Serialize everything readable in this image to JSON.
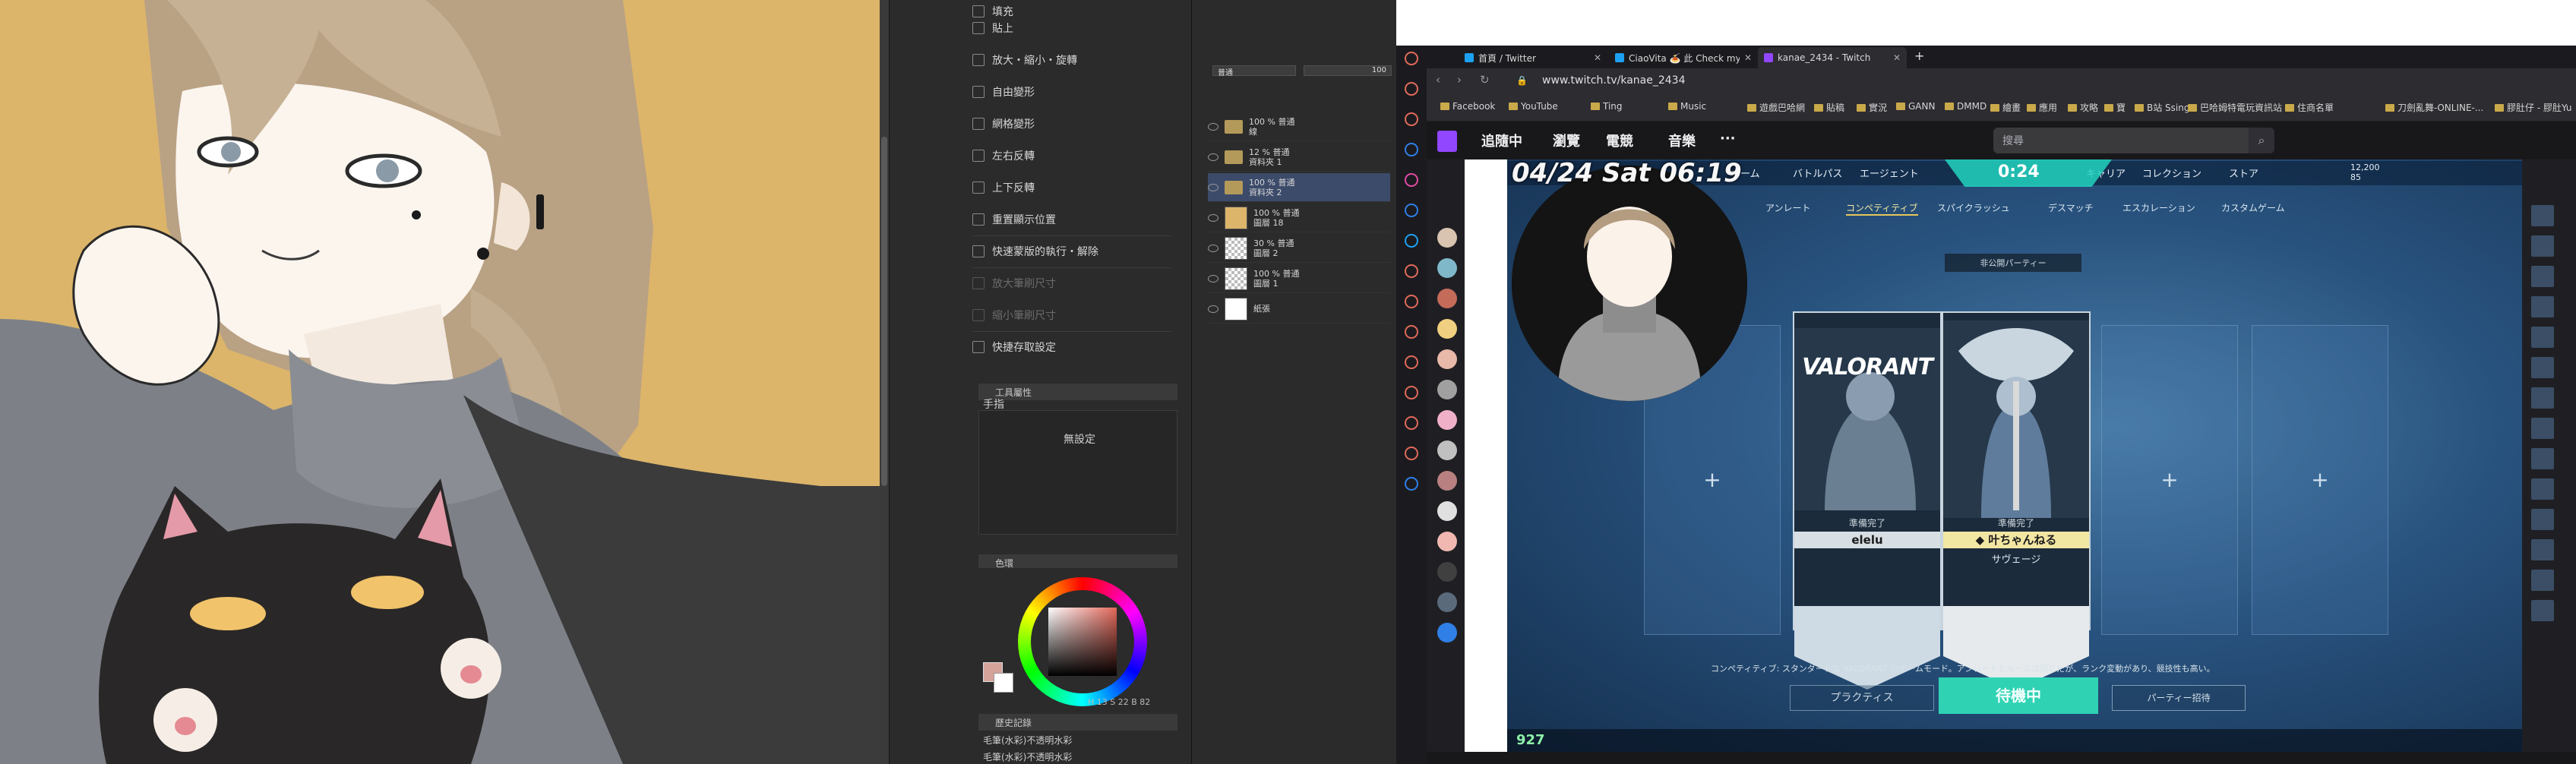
{
  "clip_studio": {
    "menu_items": [
      {
        "label": "填充",
        "dim": false
      },
      {
        "label": "貼上",
        "dim": false
      },
      {
        "label": "放大・縮小・旋轉",
        "dim": false
      },
      {
        "label": "自由變形",
        "dim": false
      },
      {
        "label": "網格變形",
        "dim": false
      },
      {
        "label": "左右反轉",
        "dim": false
      },
      {
        "label": "上下反轉",
        "dim": false
      },
      {
        "label": "重置顯示位置",
        "dim": false
      },
      {
        "label": "快速蒙版的執行・解除",
        "dim": false
      },
      {
        "label": "放大筆刷尺寸",
        "dim": true
      },
      {
        "label": "縮小筆刷尺寸",
        "dim": true
      },
      {
        "label": "快捷存取設定",
        "dim": false
      }
    ],
    "subtool_panel": {
      "header": "工具屬性",
      "tool_label": "手指",
      "empty_text": "無設定"
    },
    "color_panel": {
      "header": "色環",
      "readout": "H 13  S 22  B 82"
    },
    "history": {
      "header": "歷史記錄",
      "items": [
        "毛筆(水彩)不透明水彩",
        "毛筆(水彩)不透明水彩"
      ]
    },
    "layers": [
      {
        "name": "100 % 普通",
        "sub": "線",
        "kind": "folder",
        "selected": false
      },
      {
        "name": "12 % 普通",
        "sub": "資料夾 1",
        "kind": "folder",
        "selected": false
      },
      {
        "name": "100 % 普通",
        "sub": "資料夾 2",
        "kind": "folder",
        "selected": true
      },
      {
        "name": "100 % 普通",
        "sub": "圖層 18",
        "kind": "fill",
        "selected": false
      },
      {
        "name": "30 % 普通",
        "sub": "圖層 2",
        "kind": "checker",
        "selected": false
      },
      {
        "name": "100 % 普通",
        "sub": "圖層 1",
        "kind": "checker",
        "selected": false
      },
      {
        "name": "",
        "sub": "紙張",
        "kind": "paper",
        "selected": false
      }
    ],
    "blend_mode": "普通",
    "opacity": "100"
  },
  "browser": {
    "tabs": [
      {
        "label": "首頁 / Twitter",
        "color": "#1da1f2",
        "active": false
      },
      {
        "label": "CiaoVita 🍝 此 Check my",
        "color": "#1da1f2",
        "active": false
      },
      {
        "label": "kanae_2434 - Twitch",
        "color": "#9146ff",
        "active": true
      }
    ],
    "new_tab": "+",
    "url": "www.twitch.tv/kanae_2434",
    "bookmarks": [
      "Facebook",
      "YouTube",
      "Ting",
      "Music",
      "遊戲巴哈網",
      "貼稿",
      "實況",
      "GANN",
      "DMMD",
      "繪畫",
      "應用",
      "攻略",
      "寶",
      "B站 Ssing",
      "巴哈姆特電玩資訊站",
      "住商名單",
      "刀劍亂舞-ONLINE-...",
      "膠肚仔 - 膠肚Yu"
    ]
  },
  "twitch": {
    "nav": [
      "追隨中",
      "瀏覽",
      "電競",
      "音樂",
      "···"
    ],
    "search_placeholder": "搜尋",
    "search_icon": "search-icon",
    "viewer_count": "927"
  },
  "stream": {
    "timestamp": "04/24 Sat 06:19",
    "top_nav": [
      "ホーム",
      "バトルパス",
      "エージェント",
      "キャリア",
      "コレクション",
      "ストア"
    ],
    "timer": "0:24",
    "currency": [
      "12,200",
      "85"
    ],
    "mode_tabs": [
      "アンレート",
      "コンペティティブ",
      "スパイクラッシュ",
      "デスマッチ",
      "エスカレーション",
      "カスタムゲーム"
    ],
    "active_mode": "コンペティティブ",
    "privacy": "非公開パーティー",
    "logo": "VALORANT",
    "players": [
      {
        "ready": "準備完了",
        "name": "elelu",
        "role": ""
      },
      {
        "ready": "準備完了",
        "name": "◆ 叶ちゃんねる",
        "role": "サヴェージ"
      }
    ],
    "empty_slot": "+",
    "description": "コンペティティブ: スタンダードな VALORANT のゲームモード。アンレートとルールは同じだが、ランク変動があり、競技性も高い。",
    "practice_button": "プラクティス",
    "queue_button": "待機中",
    "party_button": "パーティー招待"
  }
}
